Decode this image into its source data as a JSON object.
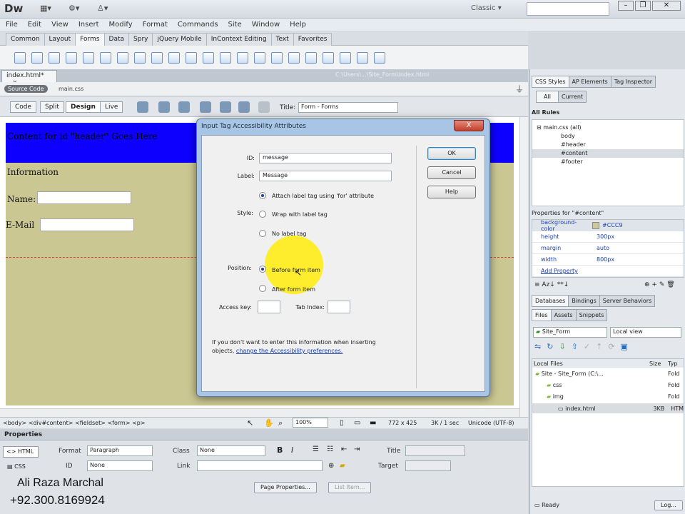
{
  "app": {
    "logo": "Dw",
    "workspace": "Classic",
    "workspace_caret": "▾"
  },
  "menu": [
    "File",
    "Edit",
    "View",
    "Insert",
    "Modify",
    "Format",
    "Commands",
    "Site",
    "Window",
    "Help"
  ],
  "insert_tabs": [
    "Common",
    "Layout",
    "Forms",
    "Data",
    "Spry",
    "jQuery Mobile",
    "InContext Editing",
    "Text",
    "Favorites"
  ],
  "document": {
    "tab": "index.html*",
    "tab_close": "×",
    "path": "C:\\Users\\...\\Site_Form\\index.html",
    "source_code": "Source Code",
    "related_file": "main.css",
    "views": [
      "Code",
      "Split",
      "Design",
      "Live"
    ],
    "title_label": "Title:",
    "title_value": "Form - Forms"
  },
  "design": {
    "header_text": "Content for id \"header\" Goes Here",
    "information": "Information",
    "name_label": "Name:",
    "email_label": "E-Mail"
  },
  "status": {
    "tags": "<body> <div#content> <fieldset> <form> <p>",
    "zoom": "100%",
    "size": "772 x 425",
    "download": "3K / 1 sec",
    "encoding": "Unicode (UTF-8)"
  },
  "properties": {
    "header": "Properties",
    "html": "HTML",
    "css": "CSS",
    "format_label": "Format",
    "format_value": "Paragraph",
    "class_label": "Class",
    "class_value": "None",
    "id_label": "ID",
    "id_value": "None",
    "link_label": "Link",
    "title_label": "Title",
    "target_label": "Target",
    "page_props": "Page Properties...",
    "list_item": "List Item...",
    "author": "Ali Raza Marchal",
    "phone": "+92.300.8169924"
  },
  "right_panel": {
    "tabs": [
      "CSS Styles",
      "AP Elements",
      "Tag Inspector"
    ],
    "modes": [
      "All",
      "Current"
    ],
    "all_rules": "All Rules",
    "rules": [
      "main.css (all)",
      "body",
      "#header",
      "#content",
      "#footer"
    ],
    "props_for": "Properties for \"#content\"",
    "props": [
      {
        "k": "background-color",
        "v": "#CCC9"
      },
      {
        "k": "height",
        "v": "300px"
      },
      {
        "k": "margin",
        "v": "auto"
      },
      {
        "k": "width",
        "v": "800px"
      }
    ],
    "add_property": "Add Property",
    "db_tabs": [
      "Databases",
      "Bindings",
      "Server Behaviors"
    ],
    "file_tabs": [
      "Files",
      "Assets",
      "Snippets"
    ],
    "site": "Site_Form",
    "view": "Local view",
    "col_local": "Local Files",
    "col_size": "Size",
    "col_type": "Typ",
    "files": [
      {
        "name": "Site - Site_Form (C:\\...",
        "size": "",
        "type": "Fold"
      },
      {
        "name": "css",
        "size": "",
        "type": "Fold"
      },
      {
        "name": "img",
        "size": "",
        "type": "Fold"
      },
      {
        "name": "index.html",
        "size": "3KB",
        "type": "HTM"
      }
    ],
    "ready": "Ready",
    "log": "Log..."
  },
  "dialog": {
    "title": "Input Tag Accessibility Attributes",
    "close": "X",
    "id_label": "ID:",
    "id_value": "message",
    "label_label": "Label:",
    "label_value": "Message",
    "style_label": "Style:",
    "style_options": [
      "Attach label tag using 'for' attribute",
      "Wrap with label tag",
      "No label tag"
    ],
    "position_label": "Position:",
    "position_options": [
      "Before form item",
      "After form item"
    ],
    "access_key": "Access key:",
    "tab_index": "Tab Index:",
    "info_text": "If you don't want to enter this information when inserting objects,",
    "info_link": "change the Accessibility preferences.",
    "ok": "OK",
    "cancel": "Cancel",
    "help": "Help"
  }
}
